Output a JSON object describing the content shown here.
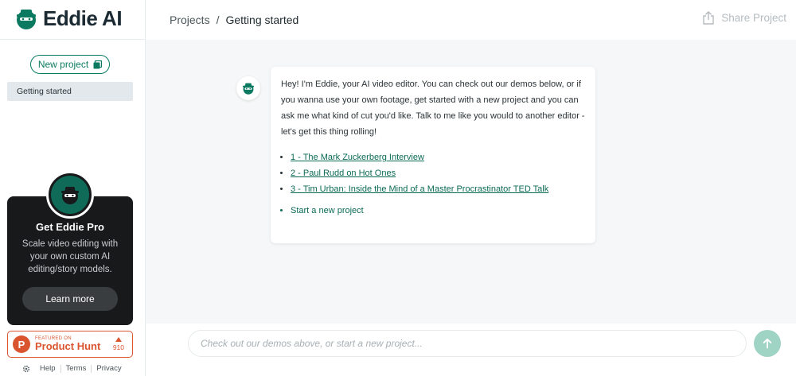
{
  "brand": {
    "name": "Eddie AI",
    "accent": "#0b7a60"
  },
  "sidebar": {
    "new_project_label": "New project",
    "projects": [
      {
        "label": "Getting started"
      }
    ],
    "pro_card": {
      "title": "Get Eddie Pro",
      "description": "Scale video editing with your own custom AI editing/story models.",
      "button_label": "Learn more"
    },
    "product_hunt": {
      "featured": "FEATURED ON",
      "name": "Product Hunt",
      "votes": "910"
    },
    "footer": {
      "help": "Help",
      "terms": "Terms",
      "privacy": "Privacy"
    }
  },
  "header": {
    "breadcrumb": {
      "root": "Projects",
      "separator": "/",
      "current": "Getting started"
    },
    "share_label": "Share Project"
  },
  "chat": {
    "message": "Hey! I'm Eddie, your AI video editor. You can check out our demos below, or if you wanna use your own footage, get started with a new project and you can ask me what kind of cut you'd like. Talk to me like you would to another editor - let's get this thing rolling!",
    "demos": [
      "1 - The Mark Zuckerberg Interview",
      "2 - Paul Rudd on Hot Ones",
      "3 - Tim Urban: Inside the Mind of a Master Procrastinator TED Talk"
    ],
    "start_link": "Start a new project"
  },
  "input": {
    "placeholder": "Check out our demos above, or start a new project...",
    "value": ""
  }
}
